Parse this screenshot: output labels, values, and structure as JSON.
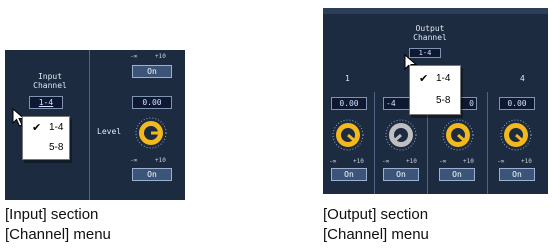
{
  "input_panel": {
    "top_scale_min": "-∞",
    "top_scale_max": "+10",
    "on_top": "On",
    "header_line1": "Input",
    "header_line2": "Channel",
    "selected_channel": "1-4",
    "value": "0.00",
    "level_label": "Level",
    "scale_min": "-∞",
    "scale_max": "+10",
    "on_bottom": "On",
    "menu": {
      "items": [
        {
          "label": "1-4",
          "checked": true
        },
        {
          "label": "5-8",
          "checked": false
        }
      ]
    }
  },
  "output_panel": {
    "header_line1": "Output",
    "header_line2": "Channel",
    "selected_channel": "1-4",
    "channel_numbers": [
      "1",
      "4"
    ],
    "values": [
      "0.00",
      "-4",
      "0",
      "0.00"
    ],
    "scale_min": "-∞",
    "scale_max": "+10",
    "on_labels": [
      "On",
      "On",
      "On",
      "On"
    ],
    "menu": {
      "items": [
        {
          "label": "1-4",
          "checked": true
        },
        {
          "label": "5-8",
          "checked": false
        }
      ]
    }
  },
  "captions": {
    "input_line1": "[Input] section",
    "input_line2": "[Channel] menu",
    "output_line1": "[Output] section",
    "output_line2": "[Channel] menu"
  },
  "colors": {
    "panel_bg": "#1d2b40",
    "knob_gold": "#f2b81c",
    "knob_gray": "#bfbfbf",
    "menu_bg": "#ffffff"
  }
}
